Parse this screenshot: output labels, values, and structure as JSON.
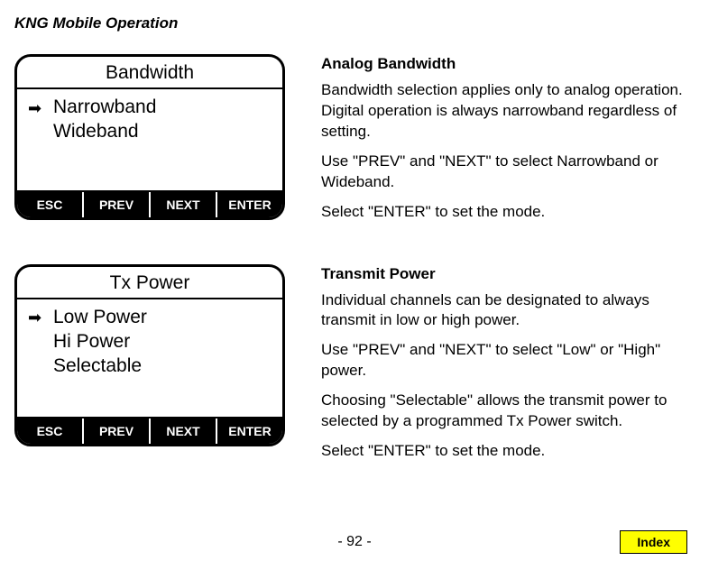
{
  "header": "KNG Mobile Operation",
  "sections": [
    {
      "device": {
        "title": "Bandwidth",
        "items": [
          {
            "label": "Narrowband",
            "selected": true
          },
          {
            "label": "Wideband",
            "selected": false
          }
        ],
        "buttons": [
          "ESC",
          "PREV",
          "NEXT",
          "ENTER"
        ]
      },
      "desc": {
        "heading": "Analog Bandwidth",
        "paragraphs": [
          "Bandwidth selection applies only to analog operation. Digital operation is always narrowband regardless of setting.",
          "Use \"PREV\" and \"NEXT\" to select Narrowband or Wideband.",
          "Select \"ENTER\" to set the mode."
        ]
      }
    },
    {
      "device": {
        "title": "Tx Power",
        "items": [
          {
            "label": "Low Power",
            "selected": true
          },
          {
            "label": "Hi Power",
            "selected": false
          },
          {
            "label": "Selectable",
            "selected": false
          }
        ],
        "buttons": [
          "ESC",
          "PREV",
          "NEXT",
          "ENTER"
        ]
      },
      "desc": {
        "heading": "Transmit Power",
        "paragraphs": [
          "Individual channels can be designated to always transmit in low or high power.",
          "Use \"PREV\" and \"NEXT\" to select \"Low\" or \"High\" power.",
          "Choosing \"Selectable\" allows the transmit power to selected by a programmed Tx Power switch.",
          "Select \"ENTER\" to set the mode."
        ]
      }
    }
  ],
  "page_number": "- 92 -",
  "index_label": "Index",
  "arrow_glyph": "➡"
}
